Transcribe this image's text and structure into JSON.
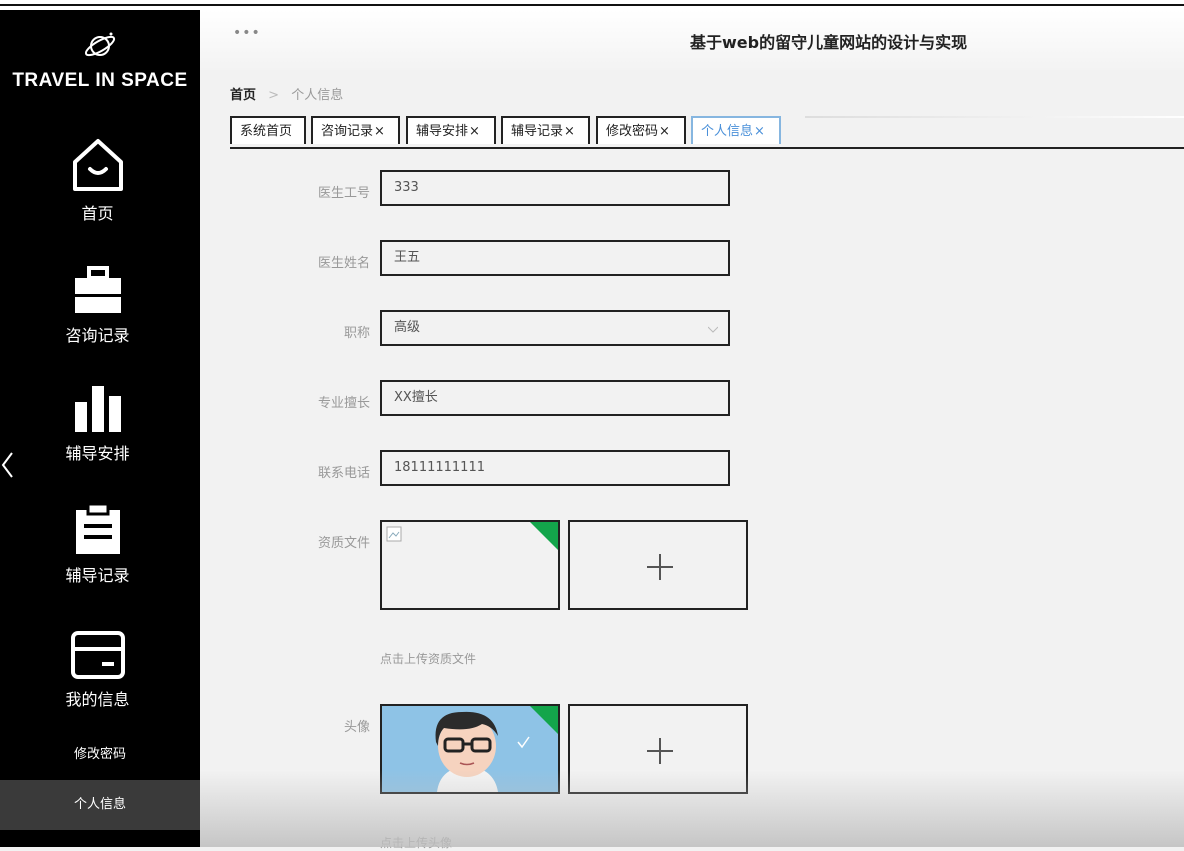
{
  "app": {
    "logo_text": "TRAVEL IN SPACE",
    "site_title": "基于web的留守儿童网站的设计与实现",
    "header_dots": "•••"
  },
  "sidebar": {
    "items": [
      {
        "label": "首页",
        "icon": "home-icon"
      },
      {
        "label": "咨询记录",
        "icon": "briefcase-icon"
      },
      {
        "label": "辅导安排",
        "icon": "bar-chart-icon"
      },
      {
        "label": "辅导记录",
        "icon": "clipboard-icon"
      },
      {
        "label": "我的信息",
        "icon": "card-icon"
      }
    ],
    "subitems": [
      {
        "label": "修改密码"
      },
      {
        "label": "个人信息"
      }
    ]
  },
  "breadcrumb": {
    "home": "首页",
    "separator": ">",
    "current": "个人信息"
  },
  "tabs": [
    {
      "label": "系统首页",
      "closable": false
    },
    {
      "label": "咨询记录",
      "closable": true
    },
    {
      "label": "辅导安排",
      "closable": true
    },
    {
      "label": "辅导记录",
      "closable": true
    },
    {
      "label": "修改密码",
      "closable": true
    },
    {
      "label": "个人信息",
      "closable": true,
      "active": true
    }
  ],
  "tab_close": "×",
  "form": {
    "doctor_id": {
      "label": "医生工号",
      "value": "333"
    },
    "doctor_name": {
      "label": "医生姓名",
      "value": "王五"
    },
    "title": {
      "label": "职称",
      "value": "高级"
    },
    "specialty": {
      "label": "专业擅长",
      "value": "XX擅长"
    },
    "phone": {
      "label": "联系电话",
      "value": "18111111111"
    },
    "qualification": {
      "label": "资质文件",
      "hint": "点击上传资质文件"
    },
    "avatar": {
      "label": "头像",
      "hint": "点击上传头像"
    }
  },
  "colors": {
    "sidebar_bg": "#000000",
    "active_tab": "#4a90d9",
    "upload_success": "#13a54b"
  }
}
